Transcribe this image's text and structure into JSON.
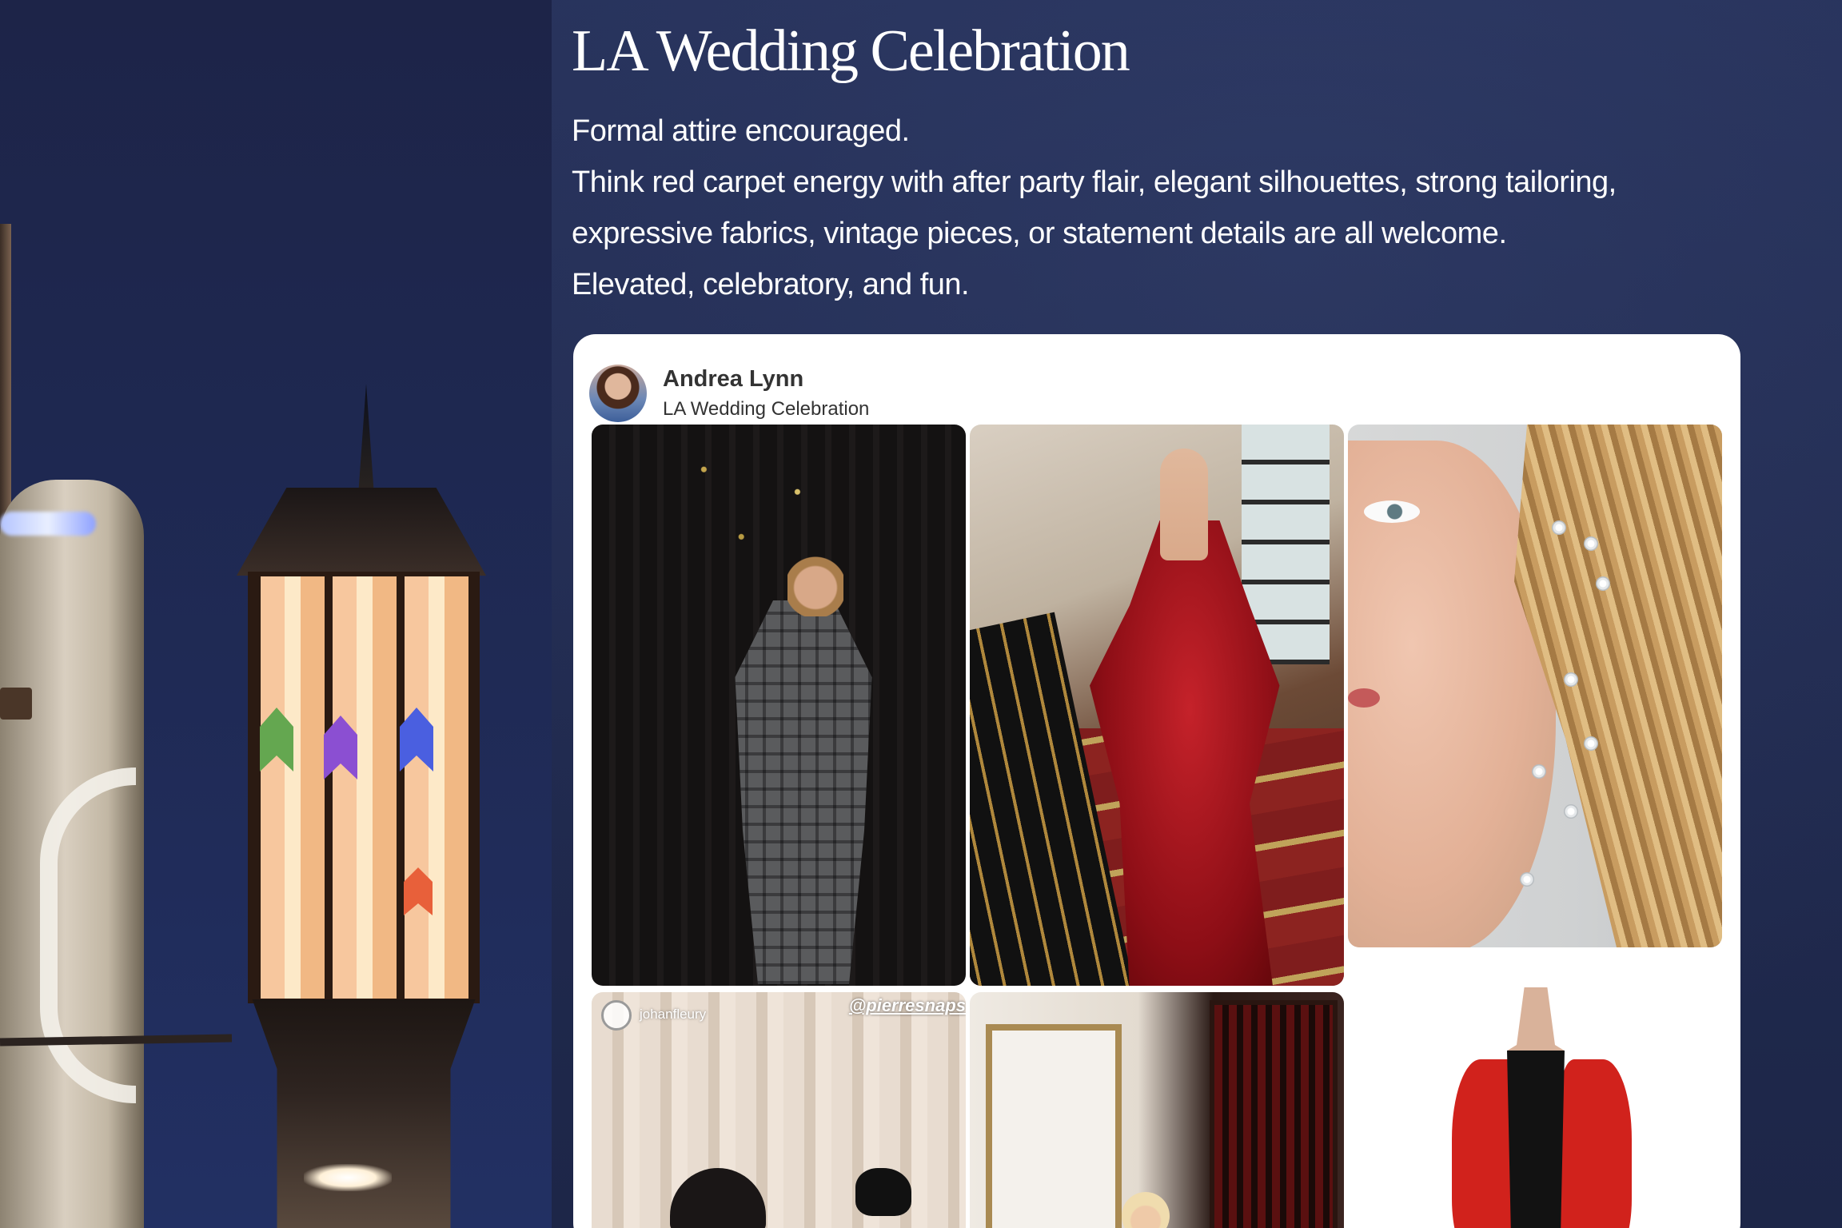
{
  "page": {
    "title": "LA Wedding Celebration",
    "description": [
      "Formal attire encouraged.",
      "Think red carpet energy with after party flair, elegant silhouettes, strong tailoring, expressive fabrics, vintage pieces, or statement details are all welcome.",
      "Elevated, celebratory, and fun."
    ]
  },
  "board": {
    "owner_name": "Andrea Lynn",
    "board_name": "LA Wedding Celebration",
    "pins": [
      {
        "id": "pin-1",
        "subject": "plaid suit with sunglasses"
      },
      {
        "id": "pin-2",
        "subject": "red sequin gown on staircase"
      },
      {
        "id": "pin-3",
        "subject": "crystal hair jewels close-up"
      },
      {
        "id": "pin-4",
        "watermark_user": "johanfleury",
        "watermark_handle": "@pierresnaps"
      },
      {
        "id": "pin-5",
        "subject": "gilded mirror interior"
      },
      {
        "id": "pin-6",
        "subject": "black gown with red stole"
      }
    ]
  },
  "colors": {
    "background": "#212c52",
    "text": "#ffffff",
    "card": "#ffffff",
    "card_text": "#333333"
  }
}
